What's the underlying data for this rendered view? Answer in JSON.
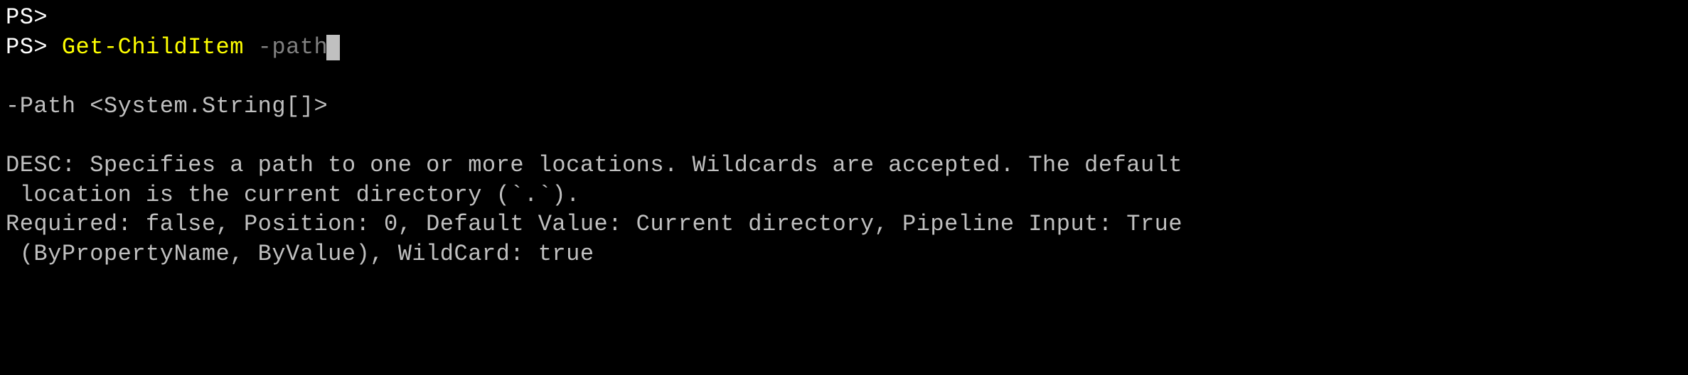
{
  "terminal": {
    "lines": {
      "prompt_empty": "PS>",
      "prompt_prefix": "PS> ",
      "command": "Get-ChildItem",
      "command_sep": " ",
      "param_typed": "-path",
      "help_signature": "-Path <System.String[]>",
      "help_desc_line1": "DESC: Specifies a path to one or more locations. Wildcards are accepted. The default",
      "help_desc_line2": " location is the current directory (`.`).",
      "help_meta_line1": "Required: false, Position: 0, Default Value: Current directory, Pipeline Input: True",
      "help_meta_line2": " (ByPropertyName, ByValue), WildCard: true"
    }
  }
}
